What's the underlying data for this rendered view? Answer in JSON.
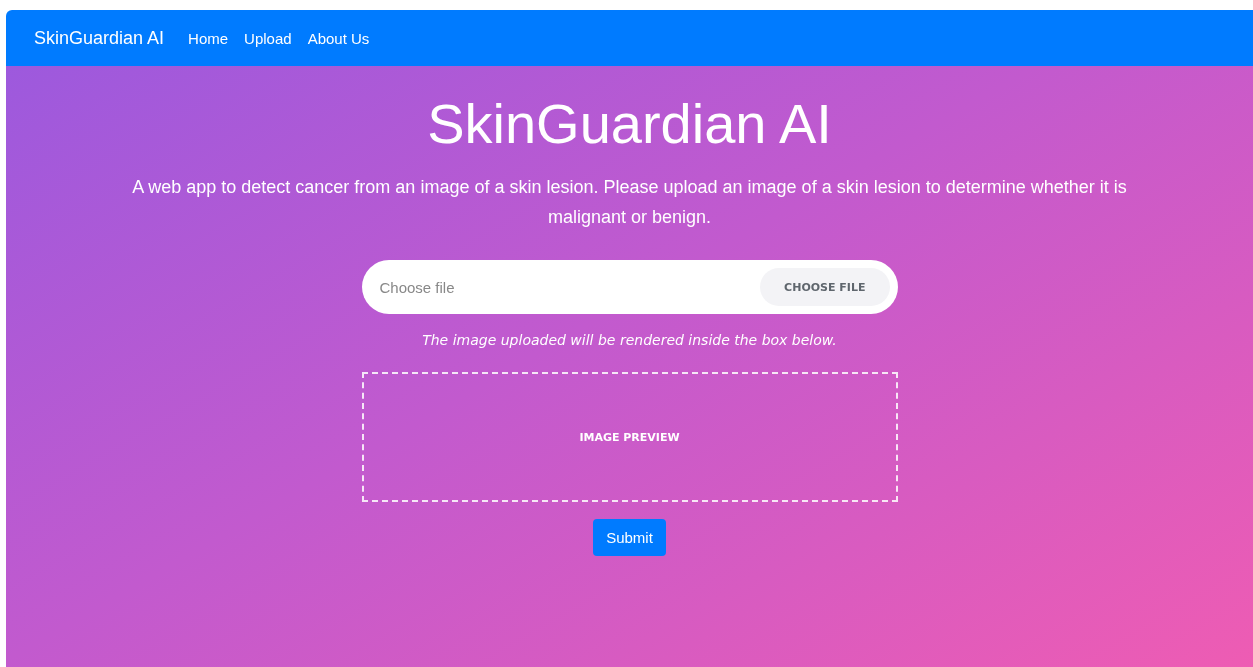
{
  "navbar": {
    "brand": "SkinGuardian AI",
    "links": [
      "Home",
      "Upload",
      "About Us"
    ]
  },
  "hero": {
    "title": "SkinGuardian AI",
    "description": "A web app to detect cancer from an image of a skin lesion. Please upload an image of a skin lesion to determine whether it is malignant or benign."
  },
  "file_input": {
    "placeholder": "Choose file",
    "button": "CHOOSE FILE"
  },
  "note": "The image uploaded will be rendered inside the box below.",
  "preview": {
    "label": "IMAGE PREVIEW"
  },
  "submit": "Submit"
}
